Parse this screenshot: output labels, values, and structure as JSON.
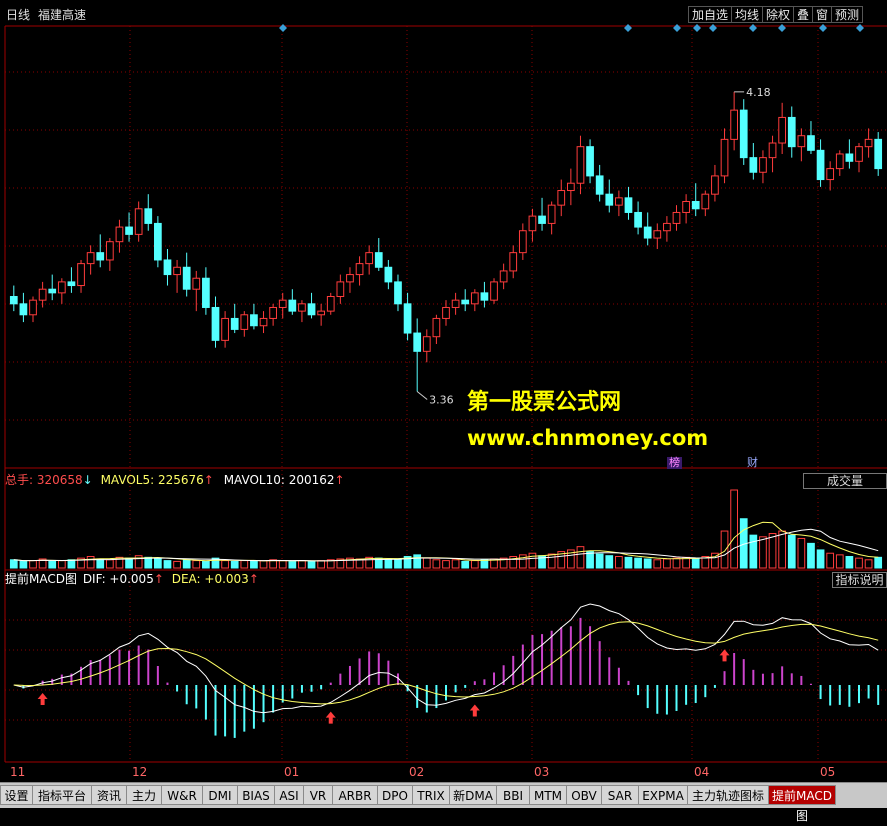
{
  "header": {
    "period": "日线",
    "stock_name": "福建高速",
    "buttons": [
      "加自选",
      "均线",
      "除权",
      "叠",
      "窗",
      "预测"
    ]
  },
  "price_chart": {
    "high_label": "4.18",
    "low_label": "3.36",
    "y_range": [
      3.2,
      4.3
    ],
    "event_tags": [
      "榜",
      "财"
    ]
  },
  "watermark": {
    "line1": "第一股票公式网",
    "line2": "www.chnmoney.com"
  },
  "volume_panel": {
    "label_total": "总手: 320658",
    "arrow_total": "↓",
    "label_mavol5": "MAVOL5: 225676",
    "arrow_mavol5": "↑",
    "label_mavol10": "MAVOL10: 200162",
    "arrow_mavol10": "↑",
    "indicator_button": "成交量"
  },
  "macd_panel": {
    "label_name": "提前MACD图",
    "label_dif": "DIF: +0.005",
    "arrow_dif": "↑",
    "label_dea": "DEA: +0.003",
    "arrow_dea": "↑",
    "help_button": "指标说明"
  },
  "x_axis": {
    "month_labels": [
      "11",
      "12",
      "01",
      "02",
      "03",
      "04",
      "05"
    ]
  },
  "tabs": [
    "设置",
    "指标平台",
    "资讯",
    "主力",
    "W&R",
    "DMI",
    "BIAS",
    "ASI",
    "VR",
    "ARBR",
    "DPO",
    "TRIX",
    "新DMA",
    "BBI",
    "MTM",
    "OBV",
    "SAR",
    "EXPMA",
    "主力轨迹图标",
    "提前MACD图"
  ],
  "colors": {
    "up": "#ff3c3c",
    "down": "#54ffff",
    "grid": "#8b0000",
    "ma5": "#ffffff",
    "ma10": "#ffff66",
    "macd_pos": "#cc44cc",
    "macd_neg": "#54ffff",
    "signal_arrow": "#ff3c3c"
  },
  "chart_data": {
    "type": "candlestick",
    "series": [
      {
        "name": "K",
        "ohlc": [
          [
            3.62,
            3.65,
            3.58,
            3.6
          ],
          [
            3.6,
            3.63,
            3.55,
            3.57
          ],
          [
            3.57,
            3.62,
            3.55,
            3.61
          ],
          [
            3.61,
            3.66,
            3.59,
            3.64
          ],
          [
            3.64,
            3.68,
            3.61,
            3.63
          ],
          [
            3.63,
            3.67,
            3.6,
            3.66
          ],
          [
            3.66,
            3.7,
            3.63,
            3.65
          ],
          [
            3.65,
            3.72,
            3.63,
            3.71
          ],
          [
            3.71,
            3.76,
            3.68,
            3.74
          ],
          [
            3.74,
            3.79,
            3.7,
            3.72
          ],
          [
            3.72,
            3.78,
            3.69,
            3.77
          ],
          [
            3.77,
            3.83,
            3.74,
            3.81
          ],
          [
            3.81,
            3.85,
            3.77,
            3.79
          ],
          [
            3.79,
            3.88,
            3.77,
            3.86
          ],
          [
            3.86,
            3.9,
            3.8,
            3.82
          ],
          [
            3.82,
            3.84,
            3.7,
            3.72
          ],
          [
            3.72,
            3.75,
            3.65,
            3.68
          ],
          [
            3.68,
            3.72,
            3.63,
            3.7
          ],
          [
            3.7,
            3.74,
            3.62,
            3.64
          ],
          [
            3.64,
            3.69,
            3.58,
            3.67
          ],
          [
            3.67,
            3.7,
            3.57,
            3.59
          ],
          [
            3.59,
            3.62,
            3.48,
            3.5
          ],
          [
            3.5,
            3.58,
            3.48,
            3.56
          ],
          [
            3.56,
            3.6,
            3.52,
            3.53
          ],
          [
            3.53,
            3.58,
            3.51,
            3.57
          ],
          [
            3.57,
            3.6,
            3.53,
            3.54
          ],
          [
            3.54,
            3.58,
            3.52,
            3.56
          ],
          [
            3.56,
            3.6,
            3.54,
            3.59
          ],
          [
            3.59,
            3.63,
            3.56,
            3.61
          ],
          [
            3.61,
            3.64,
            3.57,
            3.58
          ],
          [
            3.58,
            3.61,
            3.55,
            3.6
          ],
          [
            3.6,
            3.63,
            3.56,
            3.57
          ],
          [
            3.57,
            3.6,
            3.54,
            3.58
          ],
          [
            3.58,
            3.63,
            3.57,
            3.62
          ],
          [
            3.62,
            3.68,
            3.6,
            3.66
          ],
          [
            3.66,
            3.7,
            3.63,
            3.68
          ],
          [
            3.68,
            3.73,
            3.65,
            3.71
          ],
          [
            3.71,
            3.76,
            3.68,
            3.74
          ],
          [
            3.74,
            3.78,
            3.69,
            3.7
          ],
          [
            3.7,
            3.72,
            3.64,
            3.66
          ],
          [
            3.66,
            3.68,
            3.58,
            3.6
          ],
          [
            3.6,
            3.63,
            3.5,
            3.52
          ],
          [
            3.52,
            3.56,
            3.36,
            3.47
          ],
          [
            3.47,
            3.53,
            3.44,
            3.51
          ],
          [
            3.51,
            3.57,
            3.49,
            3.56
          ],
          [
            3.56,
            3.61,
            3.54,
            3.59
          ],
          [
            3.59,
            3.63,
            3.57,
            3.61
          ],
          [
            3.61,
            3.64,
            3.58,
            3.6
          ],
          [
            3.6,
            3.64,
            3.58,
            3.63
          ],
          [
            3.63,
            3.66,
            3.59,
            3.61
          ],
          [
            3.61,
            3.67,
            3.6,
            3.66
          ],
          [
            3.66,
            3.71,
            3.64,
            3.69
          ],
          [
            3.69,
            3.76,
            3.67,
            3.74
          ],
          [
            3.74,
            3.82,
            3.72,
            3.8
          ],
          [
            3.8,
            3.86,
            3.77,
            3.84
          ],
          [
            3.84,
            3.89,
            3.8,
            3.82
          ],
          [
            3.82,
            3.88,
            3.79,
            3.87
          ],
          [
            3.87,
            3.94,
            3.84,
            3.91
          ],
          [
            3.91,
            3.97,
            3.87,
            3.93
          ],
          [
            3.93,
            4.06,
            3.9,
            4.03
          ],
          [
            4.03,
            4.05,
            3.93,
            3.95
          ],
          [
            3.95,
            3.98,
            3.88,
            3.9
          ],
          [
            3.9,
            3.94,
            3.85,
            3.87
          ],
          [
            3.87,
            3.91,
            3.84,
            3.89
          ],
          [
            3.89,
            3.92,
            3.83,
            3.85
          ],
          [
            3.85,
            3.88,
            3.79,
            3.81
          ],
          [
            3.81,
            3.85,
            3.76,
            3.78
          ],
          [
            3.78,
            3.82,
            3.75,
            3.8
          ],
          [
            3.8,
            3.84,
            3.77,
            3.82
          ],
          [
            3.82,
            3.87,
            3.8,
            3.85
          ],
          [
            3.85,
            3.9,
            3.82,
            3.88
          ],
          [
            3.88,
            3.93,
            3.84,
            3.86
          ],
          [
            3.86,
            3.91,
            3.84,
            3.9
          ],
          [
            3.9,
            3.98,
            3.88,
            3.95
          ],
          [
            3.95,
            4.08,
            3.93,
            4.05
          ],
          [
            4.05,
            4.18,
            4.02,
            4.13
          ],
          [
            4.13,
            4.16,
            3.98,
            4.0
          ],
          [
            4.0,
            4.04,
            3.94,
            3.96
          ],
          [
            3.96,
            4.02,
            3.93,
            4.0
          ],
          [
            4.0,
            4.06,
            3.96,
            4.04
          ],
          [
            4.04,
            4.15,
            4.01,
            4.11
          ],
          [
            4.11,
            4.14,
            4.0,
            4.03
          ],
          [
            4.03,
            4.08,
            3.99,
            4.06
          ],
          [
            4.06,
            4.1,
            4.01,
            4.02
          ],
          [
            4.02,
            4.05,
            3.92,
            3.94
          ],
          [
            3.94,
            3.99,
            3.91,
            3.97
          ],
          [
            3.97,
            4.02,
            3.95,
            4.01
          ],
          [
            4.01,
            4.05,
            3.97,
            3.99
          ],
          [
            3.99,
            4.04,
            3.96,
            4.03
          ],
          [
            4.03,
            4.08,
            4.0,
            4.05
          ],
          [
            4.05,
            4.07,
            3.95,
            3.97
          ]
        ]
      },
      {
        "name": "成交量",
        "values": [
          10,
          8,
          9,
          11,
          8,
          9,
          10,
          12,
          14,
          11,
          10,
          13,
          12,
          15,
          13,
          11,
          9,
          8,
          10,
          9,
          8,
          12,
          9,
          8,
          9,
          8,
          9,
          10,
          9,
          8,
          9,
          8,
          9,
          10,
          11,
          12,
          11,
          13,
          12,
          10,
          11,
          14,
          16,
          12,
          10,
          9,
          10,
          8,
          9,
          10,
          11,
          12,
          14,
          16,
          18,
          15,
          17,
          20,
          22,
          26,
          20,
          17,
          15,
          14,
          13,
          12,
          11,
          10,
          11,
          12,
          13,
          12,
          14,
          18,
          45,
          95,
          60,
          40,
          38,
          42,
          45,
          40,
          36,
          30,
          22,
          18,
          16,
          14,
          12,
          10,
          13
        ]
      }
    ]
  }
}
